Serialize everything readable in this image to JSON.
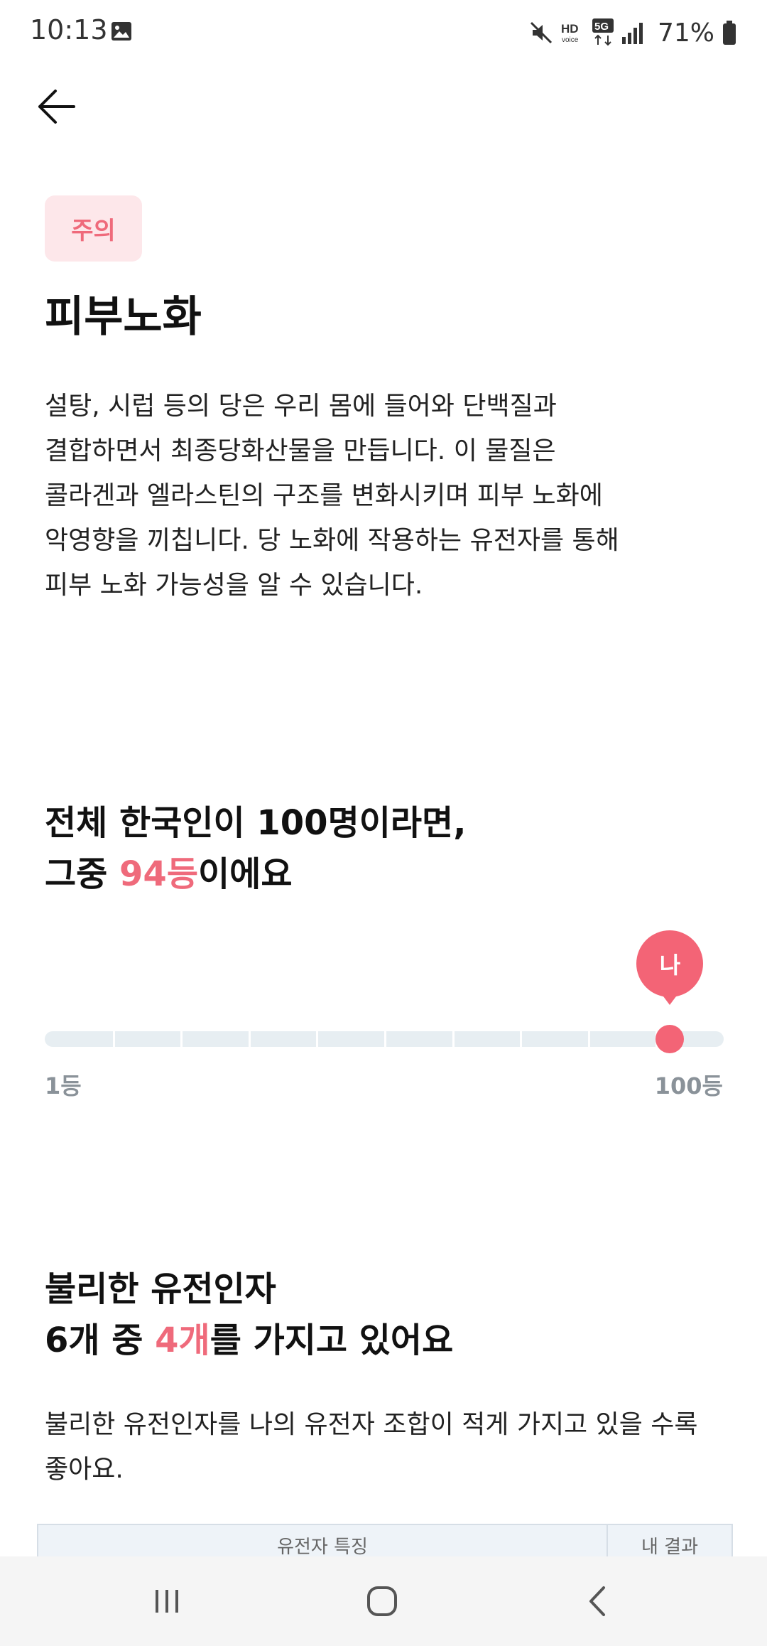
{
  "status": {
    "time": "10:13",
    "battery": "71%"
  },
  "badge": "주의",
  "title": "피부노화",
  "description": "설탕, 시럽 등의 당은 우리 몸에 들어와 단백질과\n결합하면서 최종당화산물을 만듭니다. 이 물질은\n콜라겐과 엘라스틴의 구조를 변화시키며 피부 노화에\n악영향을 끼칩니다. 당 노화에 작용하는 유전자를 통해\n피부 노화 가능성을 알 수 있습니다.",
  "ranking": {
    "line1": "전체 한국인이 100명이라면,",
    "line2_prefix": "그중 ",
    "line2_highlight": "94등",
    "line2_suffix": "이에요",
    "rank_value": 94,
    "min_label": "1등",
    "max_label": "100등",
    "marker_label": "나"
  },
  "genes": {
    "line1": "불리한 유전인자",
    "line2_prefix": "6개 중 ",
    "line2_highlight": "4개",
    "line2_suffix": "를 가지고 있어요",
    "description": "불리한 유전인자를 나의 유전자 조합이 적게 가지고 있을 수록 좋아요."
  },
  "table": {
    "col1": "유전자 특징",
    "col2": "내 결과"
  },
  "colors": {
    "accent": "#f36476",
    "badge_bg": "#fde7ea",
    "track": "#e7eef2"
  },
  "icons": [
    "gallery-icon",
    "mute-icon",
    "hd-voice-icon",
    "5g-icon",
    "signal-icon",
    "battery-icon",
    "back-arrow-icon",
    "recents-icon",
    "home-icon",
    "nav-back-icon"
  ]
}
